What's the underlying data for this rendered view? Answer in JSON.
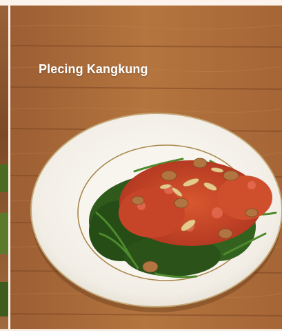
{
  "card": {
    "title": "Plecing Kangkung",
    "image_description_icon": "dish-photo"
  },
  "colors": {
    "page_background": "#fbf3ec",
    "wood": "#a8683a",
    "plate": "#f6f3ee",
    "plate_rim": "#b0925a",
    "greens": "#2f5a1c",
    "sambal": "#c8442a",
    "title_text": "#ffffff"
  }
}
